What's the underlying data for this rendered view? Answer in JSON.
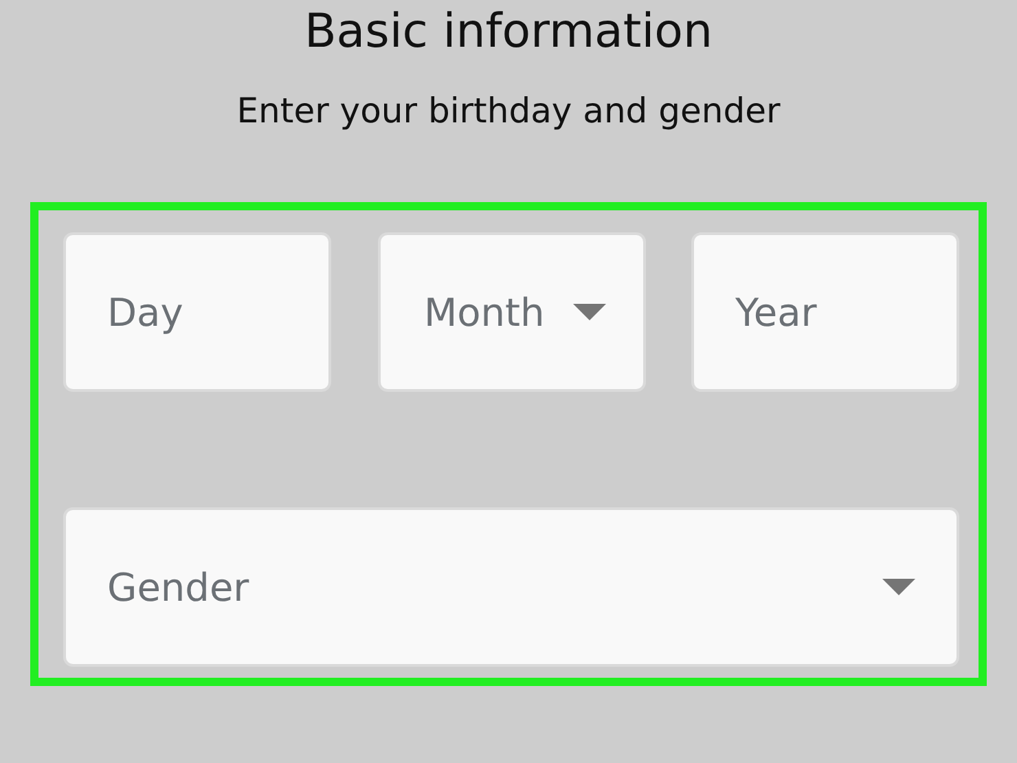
{
  "title": "Basic information",
  "subtitle": "Enter your birthday and gender",
  "rows": [
    {
      "fields": [
        {
          "kind": "text",
          "placeholder": "Day"
        },
        {
          "kind": "dropdown",
          "placeholder": "Month"
        },
        {
          "kind": "text",
          "placeholder": "Year"
        }
      ]
    },
    {
      "fields": [
        {
          "kind": "dropdown",
          "placeholder": "Gender"
        }
      ]
    }
  ]
}
